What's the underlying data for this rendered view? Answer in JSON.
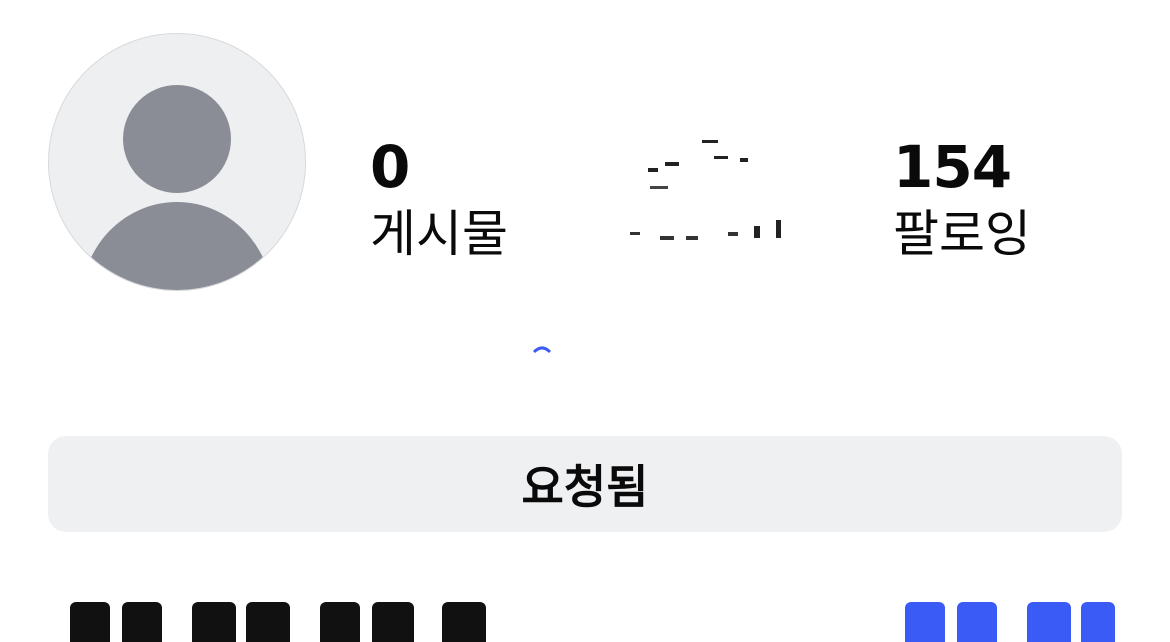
{
  "profile": {
    "avatar_icon": "default-avatar-icon"
  },
  "stats": {
    "posts": {
      "count": "0",
      "label": "게시물"
    },
    "followers": {
      "count": "",
      "label": ""
    },
    "following": {
      "count": "154",
      "label": "팔로잉"
    }
  },
  "actions": {
    "requested_label": "요청됨"
  },
  "colors": {
    "avatar_bg": "#eeeff1",
    "avatar_figure": "#8a8d96",
    "button_bg": "#eff0f2",
    "link_blue": "#3b5bf6"
  }
}
